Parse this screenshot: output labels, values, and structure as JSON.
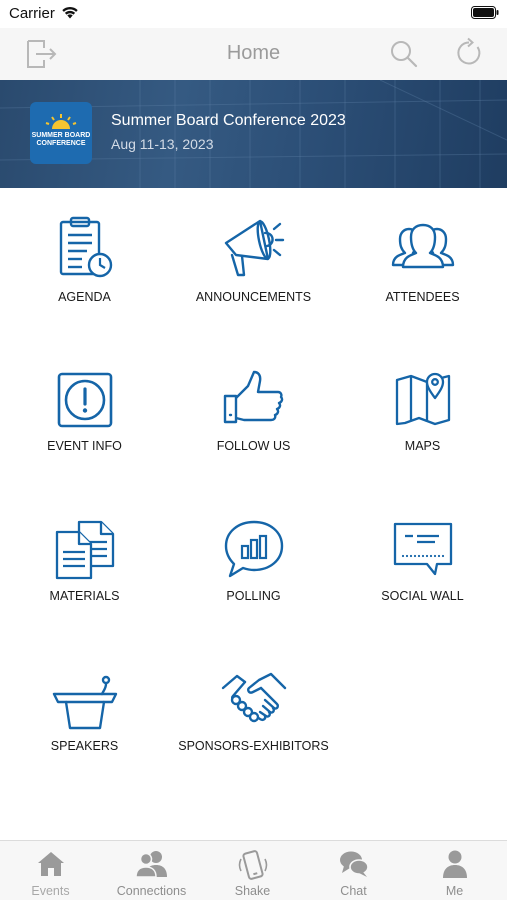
{
  "status_bar": {
    "carrier": "Carrier"
  },
  "nav": {
    "title": "Home"
  },
  "banner": {
    "logo_text": "SUMMER BOARD CONFERENCE",
    "title": "Summer Board Conference 2023",
    "dates": "Aug 11-13, 2023"
  },
  "grid": {
    "items": [
      {
        "label": "AGENDA",
        "icon": "agenda-clipboard-clock-icon"
      },
      {
        "label": "ANNOUNCEMENTS",
        "icon": "megaphone-icon"
      },
      {
        "label": "ATTENDEES",
        "icon": "people-group-icon"
      },
      {
        "label": "EVENT INFO",
        "icon": "info-exclamation-icon"
      },
      {
        "label": "FOLLOW US",
        "icon": "thumbs-up-icon"
      },
      {
        "label": "MAPS",
        "icon": "map-pin-icon"
      },
      {
        "label": "MATERIALS",
        "icon": "documents-icon"
      },
      {
        "label": "POLLING",
        "icon": "poll-chat-bubble-icon"
      },
      {
        "label": "SOCIAL WALL",
        "icon": "message-board-icon"
      },
      {
        "label": "SPEAKERS",
        "icon": "podium-microphone-icon"
      },
      {
        "label": "SPONSORS-EXHIBITORS",
        "icon": "handshake-icon"
      }
    ]
  },
  "tab_bar": {
    "tabs": [
      {
        "label": "Events",
        "icon": "house-icon"
      },
      {
        "label": "Connections",
        "icon": "two-people-icon"
      },
      {
        "label": "Shake",
        "icon": "phone-shake-icon"
      },
      {
        "label": "Chat",
        "icon": "chat-bubbles-icon"
      },
      {
        "label": "Me",
        "icon": "person-icon"
      }
    ]
  },
  "colors": {
    "icon_blue": "#1565a8",
    "nav_gray": "#9b9b9b",
    "banner_blue": "#2c4f77"
  }
}
